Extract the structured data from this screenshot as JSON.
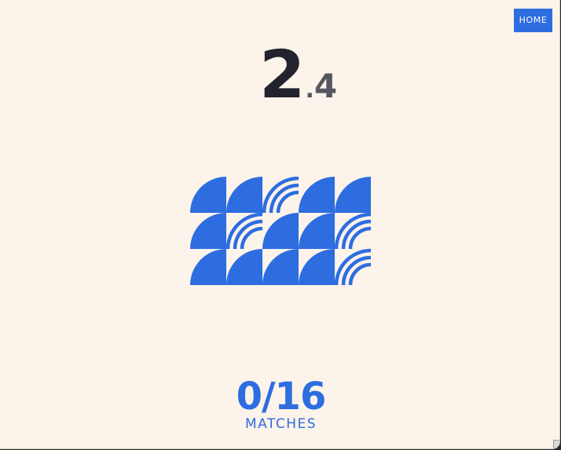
{
  "header": {
    "home_label": "HOME"
  },
  "level": {
    "major": "2",
    "separator": ".",
    "minor": "4"
  },
  "board": {
    "rows": 3,
    "cols": 5,
    "tile_color": "#2d6de0",
    "tiles": [
      [
        "quarter-solid",
        "quarter-solid",
        "quarter-rings",
        "quarter-solid",
        "quarter-solid"
      ],
      [
        "quarter-solid",
        "quarter-rings",
        "quarter-solid",
        "quarter-solid",
        "quarter-rings"
      ],
      [
        "quarter-solid",
        "quarter-solid",
        "quarter-solid",
        "quarter-solid",
        "quarter-rings"
      ]
    ]
  },
  "score": {
    "count": "0/16",
    "label": "MATCHES"
  },
  "colors": {
    "background": "#fcf3ea",
    "accent": "#2d6de0",
    "level_major": "#23232d",
    "level_minor": "#55565e"
  }
}
